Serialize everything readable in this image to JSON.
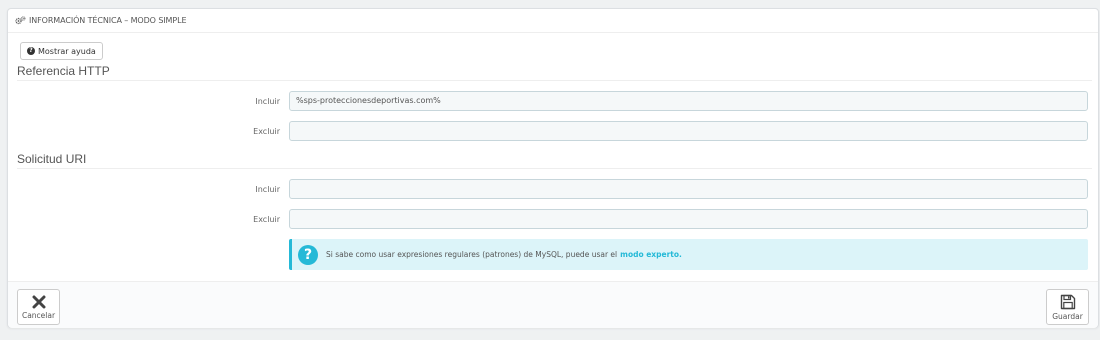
{
  "panel": {
    "heading": "Información técnica – Modo simple",
    "heading_icon": "cogs-icon"
  },
  "help_button": {
    "label": "Mostrar ayuda",
    "icon": "question-circle-icon"
  },
  "sections": [
    {
      "title": "Referencia HTTP",
      "fields": [
        {
          "label": "Incluir",
          "value": "%sps-proteccionesdeportivas.com%"
        },
        {
          "label": "Excluir",
          "value": ""
        }
      ]
    },
    {
      "title": "Solicitud URI",
      "fields": [
        {
          "label": "Incluir",
          "value": ""
        },
        {
          "label": "Excluir",
          "value": ""
        }
      ]
    }
  ],
  "info_box": {
    "text": "Si sabe como usar expresiones regulares (patrones) de MySQL, puede usar el",
    "link_text": "modo experto.",
    "icon": "question-icon",
    "accent_color": "#25b9d7"
  },
  "footer": {
    "cancel_label": "Cancelar",
    "cancel_icon": "close-icon",
    "save_label": "Guardar",
    "save_icon": "save-icon"
  }
}
